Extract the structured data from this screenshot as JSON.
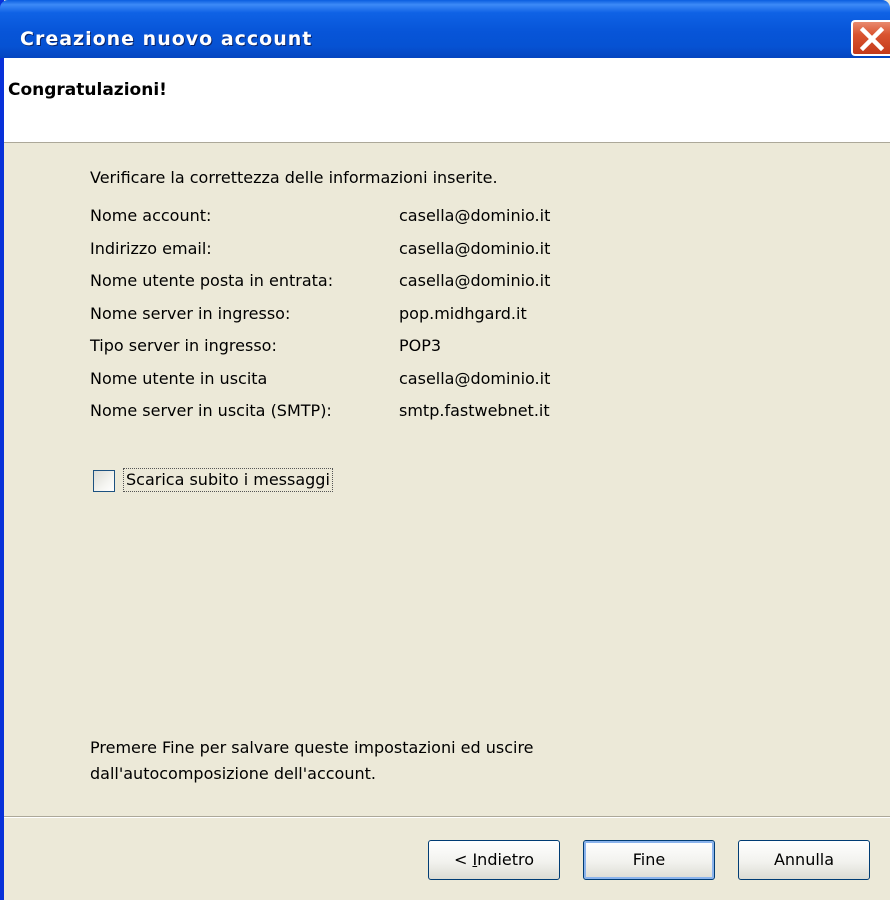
{
  "window": {
    "title": "Creazione nuovo account"
  },
  "header": {
    "title": "Congratulazioni!"
  },
  "main": {
    "intro": "Verificare la correttezza delle informazioni inserite.",
    "rows": [
      {
        "label": "Nome account:",
        "value": "casella@dominio.it"
      },
      {
        "label": "Indirizzo email:",
        "value": "casella@dominio.it"
      },
      {
        "label": "Nome utente posta in entrata:",
        "value": "casella@dominio.it"
      },
      {
        "label": "Nome server in ingresso:",
        "value": "pop.midhgard.it"
      },
      {
        "label": "Tipo server in ingresso:",
        "value": "POP3"
      },
      {
        "label": "Nome utente in uscita",
        "value": "casella@dominio.it"
      },
      {
        "label": "Nome server in uscita (SMTP):",
        "value": "smtp.fastwebnet.it"
      }
    ],
    "download_checkbox": {
      "label": "Scarica subito i messaggi",
      "checked": false
    },
    "footer_note": [
      "Premere Fine per salvare queste impostazioni ed uscire",
      "dall'autocomposizione dell'account."
    ]
  },
  "buttons": {
    "back_prefix": "< ",
    "back_access_key": "I",
    "back_rest": "ndietro",
    "finish": "Fine",
    "cancel": "Annulla"
  },
  "icons": {
    "close": "close-icon"
  },
  "colors": {
    "titlebar": "#0755d8",
    "close_button": "#d9532f",
    "dialog_background": "#ece9d8",
    "header_background": "#ffffff"
  }
}
